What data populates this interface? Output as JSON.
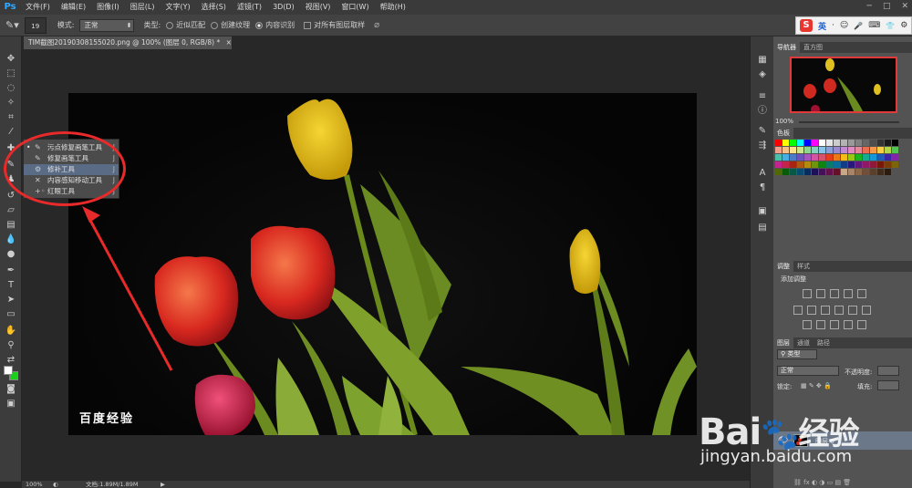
{
  "app": {
    "logo": "Ps"
  },
  "menu": [
    "文件(F)",
    "编辑(E)",
    "图像(I)",
    "图层(L)",
    "文字(Y)",
    "选择(S)",
    "滤镜(T)",
    "3D(D)",
    "视图(V)",
    "窗口(W)",
    "帮助(H)"
  ],
  "window_controls": [
    "─",
    "□",
    "✕"
  ],
  "options": {
    "brush_size": "19",
    "mode_label": "模式:",
    "mode_value": "正常",
    "type_label": "类型:",
    "type_options": [
      "近似匹配",
      "创建纹理",
      "内容识别"
    ],
    "selected_type": "内容识别",
    "sample_all_label": "对所有图层取样"
  },
  "ime": {
    "logo": "S",
    "lang": "英",
    "icons": [
      "·",
      "☺",
      "🎤",
      "⌨",
      "👕",
      "⚙"
    ]
  },
  "document": {
    "tab_title": "TIM截图20190308155020.png @ 100% (图层 0, RGB/8) *",
    "close": "×"
  },
  "flyout": {
    "items": [
      {
        "label": "污点修复画笔工具",
        "key": "J",
        "icon": "spot-healing-icon"
      },
      {
        "label": "修复画笔工具",
        "key": "J",
        "icon": "healing-brush-icon"
      },
      {
        "label": "修补工具",
        "key": "J",
        "icon": "patch-icon"
      },
      {
        "label": "内容感知移动工具",
        "key": "J",
        "icon": "content-move-icon"
      },
      {
        "label": "红眼工具",
        "key": "J",
        "icon": "red-eye-icon"
      }
    ],
    "selected_index": 2,
    "highlight_color": "#e82a2a"
  },
  "photo": {
    "watermark": "百度经验"
  },
  "status": {
    "zoom": "100%",
    "doc_size": "文档:1.89M/1.89M"
  },
  "panels": {
    "navigator": {
      "tabs": [
        "导航器",
        "直方图"
      ],
      "zoom": "100%"
    },
    "color": {
      "tabs": [
        "色板"
      ]
    },
    "adjustments": {
      "tabs": [
        "调整",
        "样式"
      ],
      "title": "添加调整"
    },
    "layers": {
      "tabs": [
        "图层",
        "通道",
        "路径"
      ],
      "kind_label": "类型",
      "blend_mode": "正常",
      "opacity_label": "不透明度:",
      "lock_label": "锁定:",
      "fill_label": "填充:",
      "layer_name": "图层 0"
    }
  },
  "baidu": {
    "main": "Bai",
    "suffix": "经验",
    "url": "jingyan.baidu.com"
  }
}
